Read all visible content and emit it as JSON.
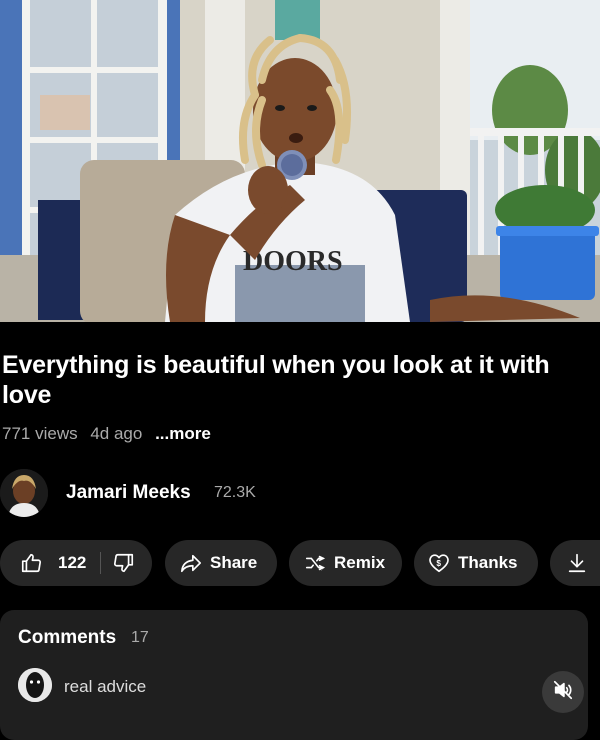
{
  "video": {
    "shirt_text": "DOORS"
  },
  "title": "Everything is beautiful when you look at it with love",
  "meta": {
    "views": "771 views",
    "age": "4d ago",
    "more": "...more"
  },
  "channel": {
    "name": "Jamari Meeks",
    "subscribers": "72.3K"
  },
  "actions": {
    "like_count": "122",
    "share_label": "Share",
    "remix_label": "Remix",
    "thanks_label": "Thanks",
    "icons": [
      "thumbs-up-icon",
      "thumbs-down-icon",
      "share-arrow-icon",
      "remix-icon",
      "thanks-heart-icon",
      "download-icon"
    ]
  },
  "comments": {
    "title": "Comments",
    "count": "17",
    "top_comment": "real advice"
  },
  "player": {
    "mute_icon": "volume-off-icon"
  },
  "colors": {
    "background": "#000000",
    "pill": "#272727",
    "card": "#1f1f1f",
    "muted_text": "#aaaaaa"
  }
}
